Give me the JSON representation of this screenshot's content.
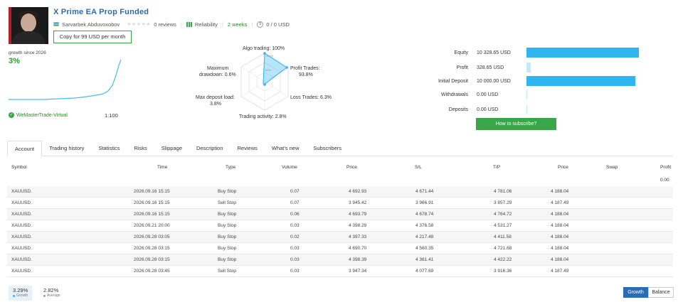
{
  "header": {
    "title": "X Prime EA Prop Funded",
    "author": "Sarvarbek Abduvoxobov",
    "reviews": "0 reviews",
    "reliability_label": "Reliability",
    "weeks": "2 weeks",
    "price": "0 / 0 USD",
    "copy_button": "Copy for 99 USD per month"
  },
  "growth": {
    "label": "growth since 2026",
    "value": "3%",
    "account": "WeMasterTrade-Virtual",
    "leverage": "1:100"
  },
  "radar": {
    "algo": "Algo trading: 100%",
    "profit_trades_1": "Profit Trades:",
    "profit_trades_2": "93.8%",
    "loss_trades": "Loss Trades: 6.3%",
    "trading_activity": "Trading activity: 2.8%",
    "max_deposit_1": "Max deposit load:",
    "max_deposit_2": "3.8%",
    "drawdown_1": "Maximum",
    "drawdown_2": "drawdown: 0.6%",
    "ring_100": "100%",
    "ring_60": "60%"
  },
  "financials": [
    {
      "label": "Equity",
      "value": "10 328.65 USD",
      "fraction": 1.0
    },
    {
      "label": "Profit",
      "value": "328.65 USD",
      "fraction": 0.035
    },
    {
      "label": "Initial Deposit",
      "value": "10 000.00 USD",
      "fraction": 0.97
    },
    {
      "label": "Withdrawals",
      "value": "0.00 USD",
      "fraction": 0
    },
    {
      "label": "Deposits",
      "value": "0.00 USD",
      "fraction": 0
    }
  ],
  "subscribe_button": "How to subscribe?",
  "tabs": [
    "Account",
    "Trading history",
    "Statistics",
    "Risks",
    "Slippage",
    "Description",
    "Reviews",
    "What's new",
    "Subscribers"
  ],
  "table": {
    "columns": [
      "Symbol",
      "Time",
      "Type",
      "Volume",
      "Price",
      "S/L",
      "T/P",
      "Price",
      "Swap",
      "Profit"
    ],
    "total": "0.00",
    "rows": [
      [
        "XAUUSD.",
        "2026.09.16 15:15",
        "Buy Stop",
        "0.07",
        "4 692.93",
        "4 671.44",
        "4 781.06",
        "4 188.04"
      ],
      [
        "XAUUSD.",
        "2026.09.16 15:15",
        "Sell Stop",
        "0.07",
        "3 945.42",
        "3 966.91",
        "3 857.29",
        "4 187.49"
      ],
      [
        "XAUUSD.",
        "2026.09.16 15:15",
        "Buy Stop",
        "0.06",
        "4 693.79",
        "4 678.74",
        "4 764.72",
        "4 188.04"
      ],
      [
        "XAUUSD.",
        "2026.09.21 20:00",
        "Buy Stop",
        "0.03",
        "4 398.29",
        "4 376.58",
        "4 531.27",
        "4 188.04"
      ],
      [
        "XAUUSD.",
        "2026.09.28 03:05",
        "Buy Stop",
        "0.02",
        "4 397.33",
        "4 217.48",
        "4 411.58",
        "4 188.04"
      ],
      [
        "XAUUSD.",
        "2026.09.28 03:15",
        "Buy Stop",
        "0.03",
        "4 690.70",
        "4 560.35",
        "4 721.68",
        "4 188.04"
      ],
      [
        "XAUUSD.",
        "2026.09.28 03:15",
        "Buy Stop",
        "0.03",
        "4 398.39",
        "4 361.41",
        "4 422.22",
        "4 188.04"
      ],
      [
        "XAUUSD.",
        "2026.09.28 03:45",
        "Sell Stop",
        "0.03",
        "3 947.34",
        "4 077.69",
        "3 916.36",
        "4 187.49"
      ]
    ]
  },
  "bottom": {
    "growth_value": "3.29%",
    "growth_label": "Growth",
    "average_value": "2.82%",
    "average_label": "Average",
    "btn_growth": "Growth",
    "btn_balance": "Balance"
  },
  "colors": {
    "accent": "#2c6cb0",
    "green": "#3aa64a",
    "bar": "#30b5f0",
    "radar": "#30b5f0"
  },
  "icons": [
    "uzbekistan-flag-icon",
    "star-icon",
    "reliability-bars-icon",
    "coin-icon",
    "verified-check-icon"
  ]
}
